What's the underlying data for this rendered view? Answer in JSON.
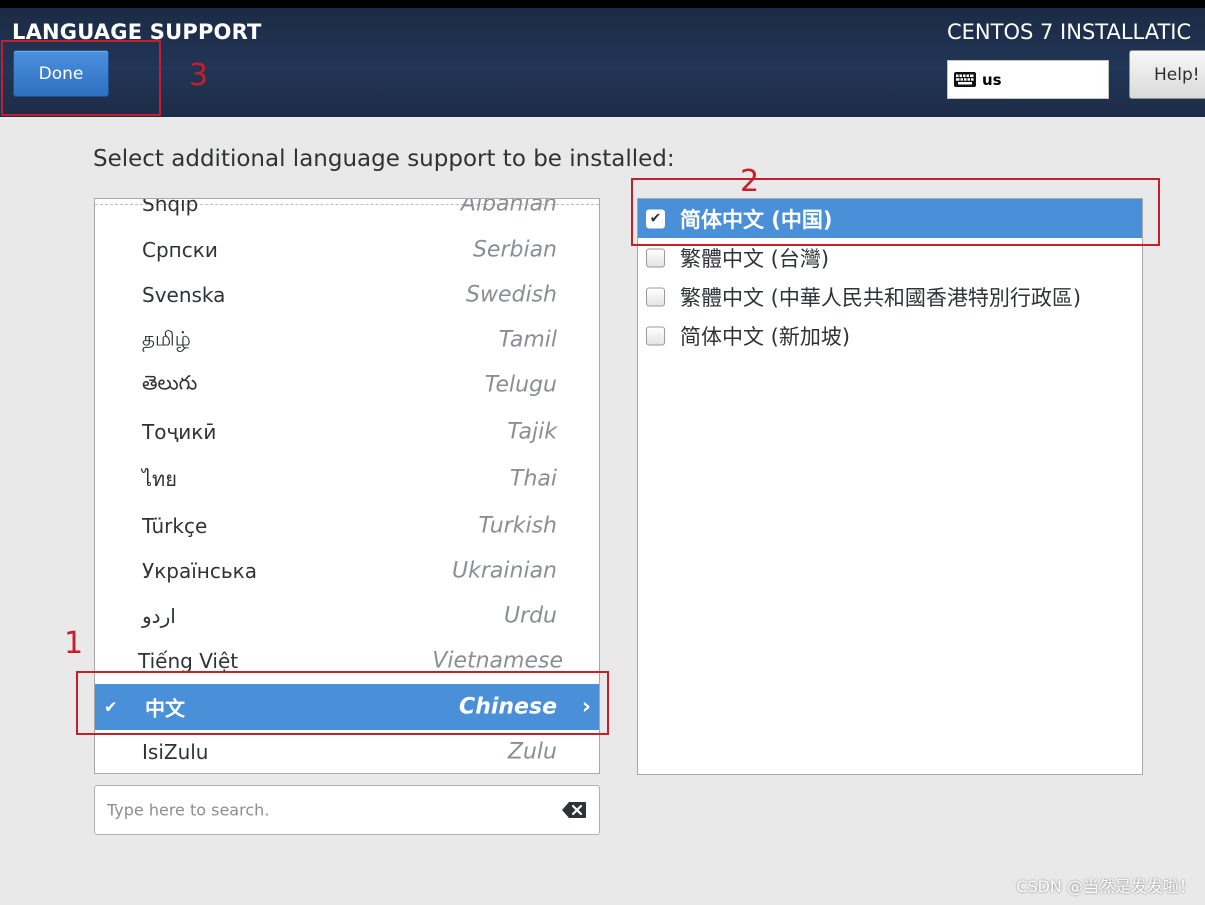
{
  "header": {
    "page_title": "LANGUAGE SUPPORT",
    "done_label": "Done",
    "product_title": "CENTOS 7 INSTALLATIC",
    "keyboard_layout": "us",
    "help_label": "Help!"
  },
  "instruction": "Select additional language support to be installed:",
  "languages": [
    {
      "native": "Shqip",
      "english": "Albanian"
    },
    {
      "native": "Српски",
      "english": "Serbian"
    },
    {
      "native": "Svenska",
      "english": "Swedish"
    },
    {
      "native": "தமிழ்",
      "english": "Tamil"
    },
    {
      "native": "తెలుగు",
      "english": "Telugu"
    },
    {
      "native": "Тоҷикӣ",
      "english": "Tajik"
    },
    {
      "native": "ไทย",
      "english": "Thai"
    },
    {
      "native": "Türkçe",
      "english": "Turkish"
    },
    {
      "native": "Українська",
      "english": "Ukrainian"
    },
    {
      "native": "اردو",
      "english": "Urdu"
    },
    {
      "native": "Tiếng Việt",
      "english": "Vietnamese"
    },
    {
      "native": "中文",
      "english": "Chinese"
    },
    {
      "native": "IsiZulu",
      "english": "Zulu"
    }
  ],
  "locales": [
    {
      "label": "简体中文 (中国)",
      "checked": true
    },
    {
      "label": "繁體中文 (台灣)",
      "checked": false
    },
    {
      "label": "繁體中文 (中華人民共和國香港特別行政區)",
      "checked": false
    },
    {
      "label": "简体中文 (新加坡)",
      "checked": false
    }
  ],
  "search": {
    "placeholder": "Type here to search."
  },
  "annotations": {
    "one": "1",
    "two": "2",
    "three": "3"
  },
  "watermark": "CSDN @当然是发发啦！",
  "colors": {
    "header_bg": "#223556",
    "selection": "#4a90d9",
    "done_button": "#3a7fd0",
    "annotation": "#c81e2b",
    "background": "#e9e9e9"
  }
}
